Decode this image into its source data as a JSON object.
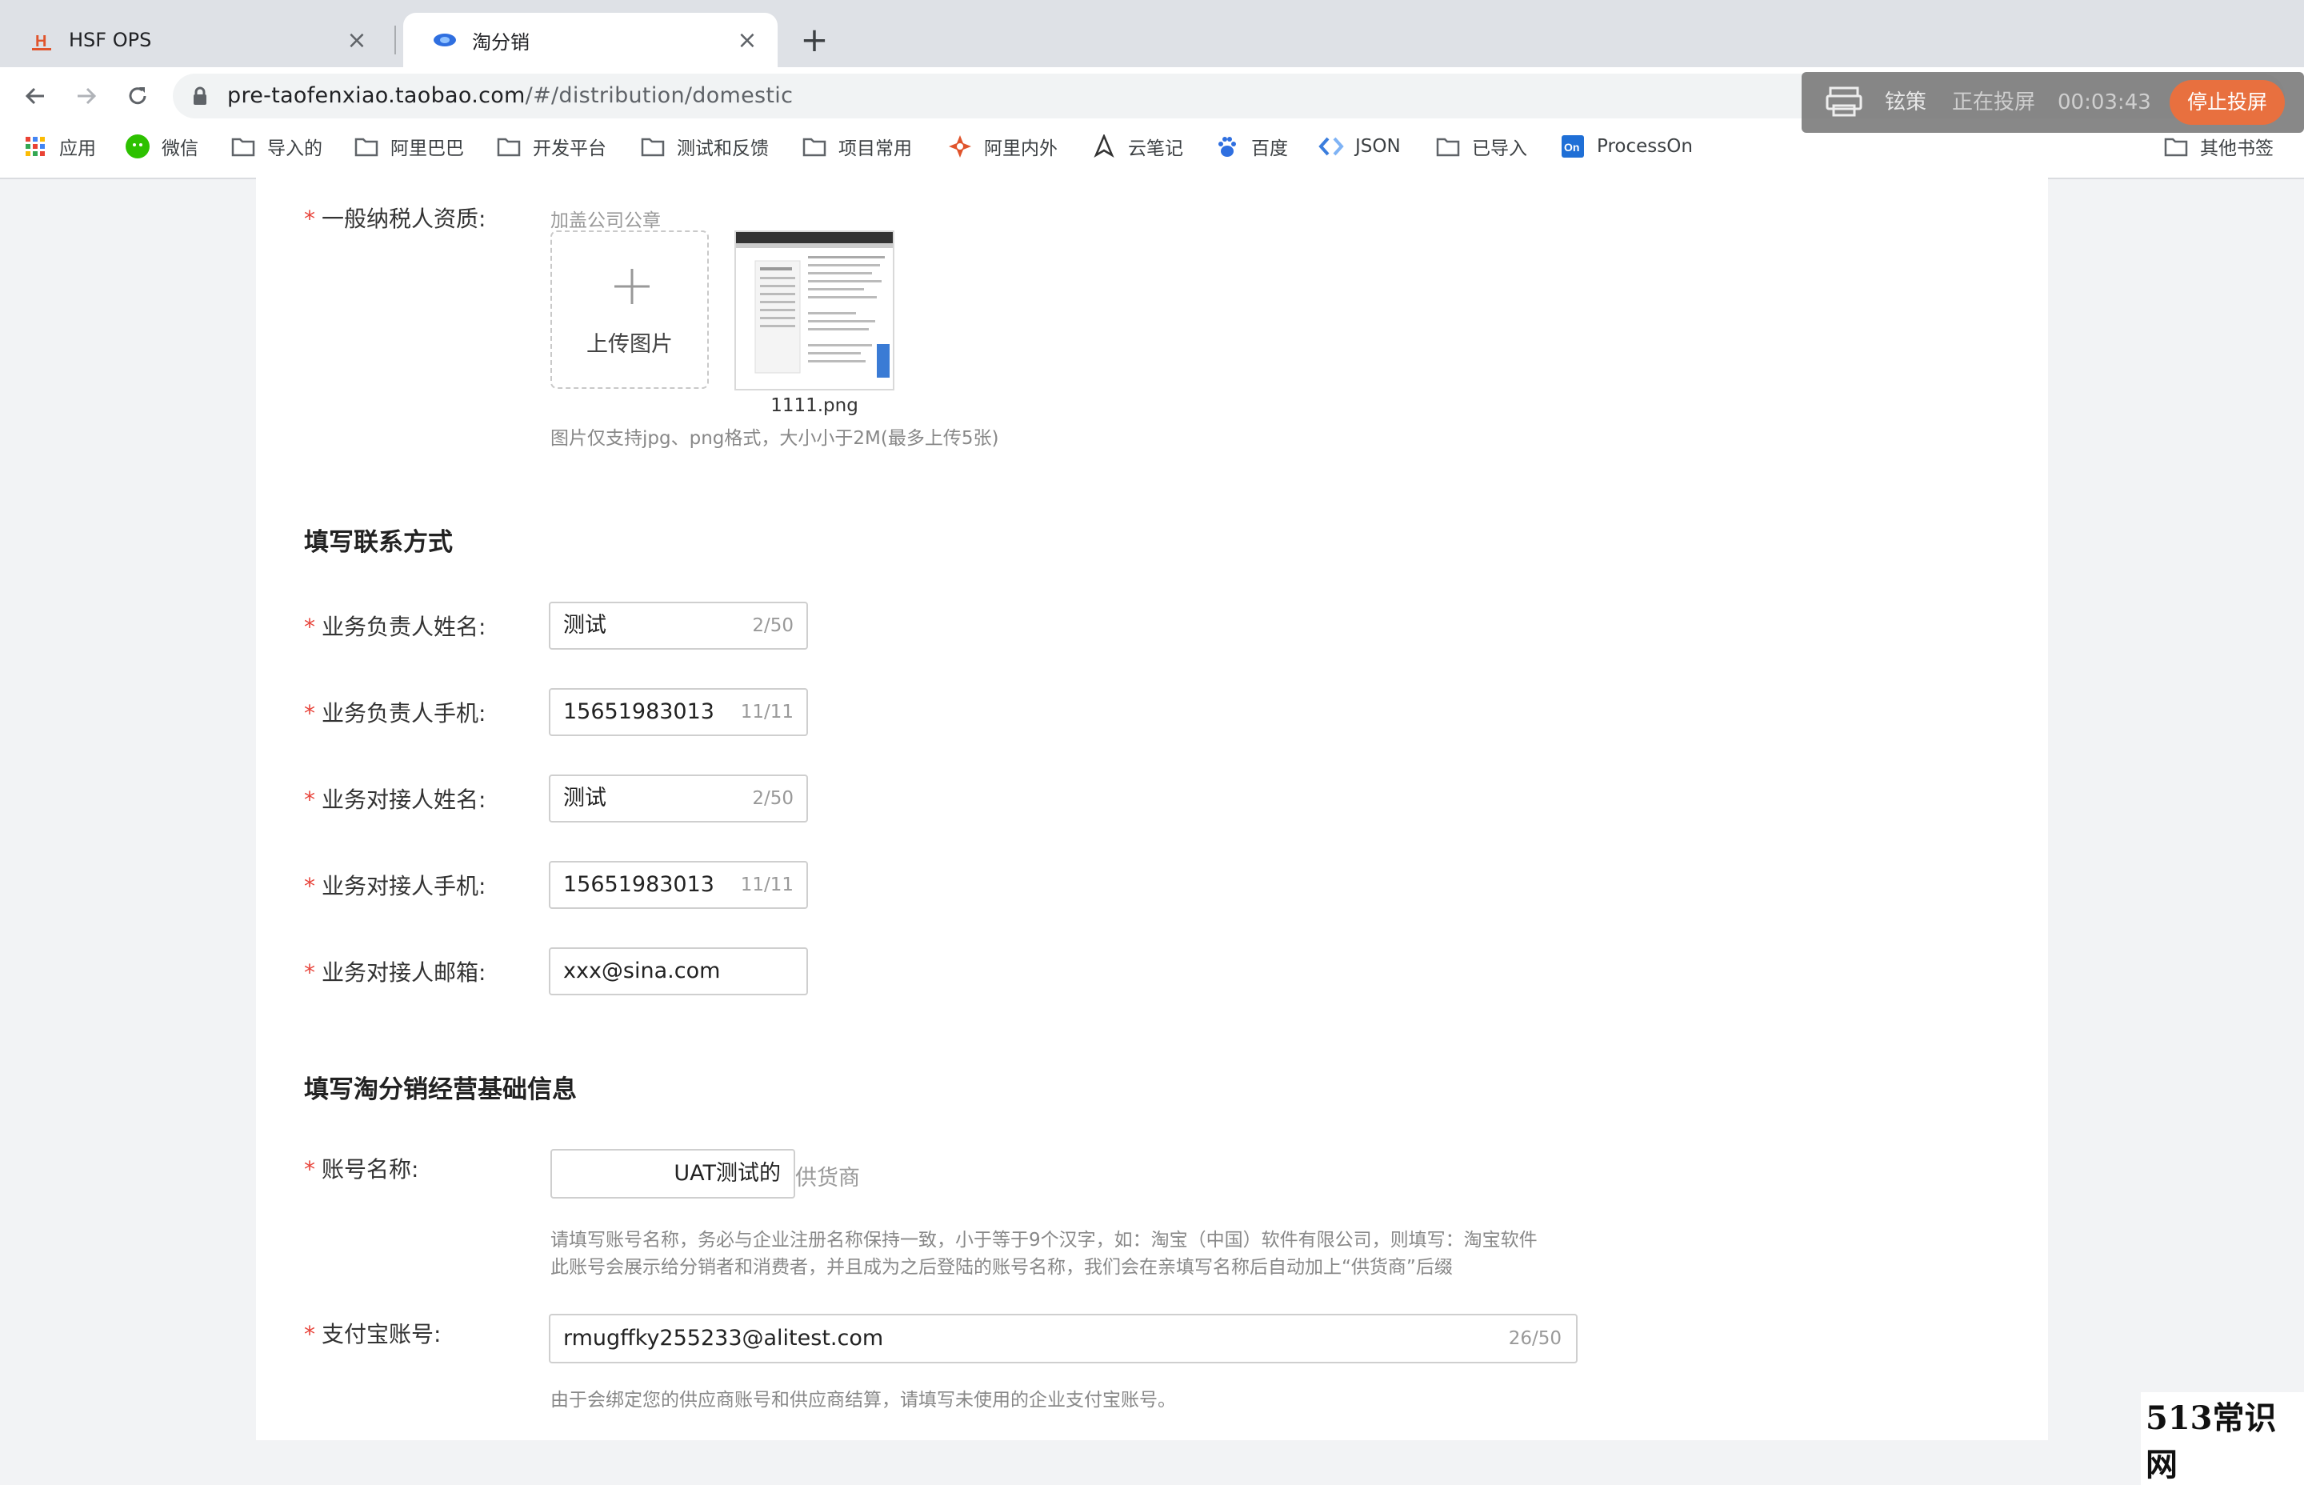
{
  "browser": {
    "tabs": [
      {
        "title": "HSF OPS",
        "favicon": "hsf-logo"
      },
      {
        "title": "淘分销",
        "favicon": "taofenxiao-logo"
      }
    ],
    "url_host": "pre-taofenxiao.taobao.com",
    "url_path": "/#/distribution/domestic",
    "bookmarks": [
      "应用",
      "微信",
      "导入的",
      "阿里巴巴",
      "开发平台",
      "测试和反馈",
      "项目常用",
      "阿里内外",
      "云笔记",
      "百度",
      "JSON",
      "已导入",
      "ProcessOn",
      "其他书签"
    ]
  },
  "cast": {
    "device": "铉策",
    "status": "正在投屏",
    "time": "00:03:43",
    "stop_label": "停止投屏"
  },
  "form": {
    "taxpayer": {
      "label": "一般纳税人资质:",
      "seal_hint": "加盖公司公章",
      "upload_label": "上传图片",
      "file_name": "1111.png",
      "format_hint": "图片仅支持jpg、png格式，大小小于2M(最多上传5张)"
    },
    "contact_section": "填写联系方式",
    "contacts": [
      {
        "label": "业务负责人姓名:",
        "value": "测试",
        "count": "2/50"
      },
      {
        "label": "业务负责人手机:",
        "value": "15651983013",
        "count": "11/11"
      },
      {
        "label": "业务对接人姓名:",
        "value": "测试",
        "count": "2/50"
      },
      {
        "label": "业务对接人手机:",
        "value": "15651983013",
        "count": "11/11"
      },
      {
        "label": "业务对接人邮箱:",
        "value": "xxx@sina.com",
        "count": ""
      }
    ],
    "business_section": "填写淘分销经营基础信息",
    "account": {
      "label": "账号名称:",
      "value": "UAT测试的",
      "suffix": "供货商",
      "hint1": "请填写账号名称，务必与企业注册名称保持一致，小于等于9个汉字，如：淘宝（中国）软件有限公司，则填写：淘宝软件",
      "hint2": "此账号会展示给分销者和消费者，并且成为之后登陆的账号名称，我们会在亲填写名称后自动加上“供货商”后缀"
    },
    "alipay": {
      "label": "支付宝账号:",
      "value": "rmugffky255233@alitest.com",
      "count": "26/50",
      "hint": "由于会绑定您的供应商账号和供应商结算，请填写未使用的企业支付宝账号。"
    }
  },
  "watermark": "513常识网"
}
